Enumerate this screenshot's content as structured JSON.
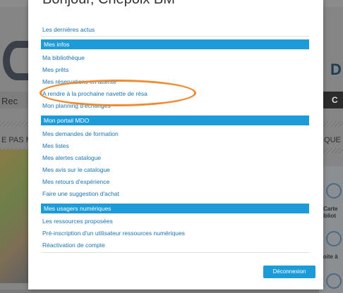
{
  "modal": {
    "title": "Bonjour, Chepoix BM",
    "latest_news": "Les dernières actus",
    "sections": [
      {
        "header": "Mes infos",
        "links": [
          "Ma bibliothèque",
          "Mes prêts",
          "Mes réservations en attente",
          "A rendre à la prochaine navette de résa",
          "Mon planning d'échanges"
        ]
      },
      {
        "header": "Mon portail MDO",
        "links": [
          "Mes demandes de formation",
          "Mes listes",
          "Mes alertes catalogue",
          "Mes avis sur le catalogue",
          "Mes retours d'expérience",
          "Faire une suggestion d'achat"
        ]
      },
      {
        "header": "Mes usagers numériques",
        "links": [
          "Les ressources proposées",
          "Pré-inscription d'un utilisateur ressources numériques",
          "Réactivation de compte"
        ]
      }
    ],
    "logout_label": "Déconnexion"
  },
  "background": {
    "left_text_1": "Rec",
    "left_text_2": "E PAS M",
    "right_text_1": "D",
    "right_text_2": "IQUE",
    "right_text_3": "C",
    "right_text_4": "Carte",
    "right_text_5": "bibliot",
    "right_text_6": "Boite à"
  },
  "colors": {
    "accent": "#1c9bd8",
    "annotation": "#ef8a2e"
  }
}
